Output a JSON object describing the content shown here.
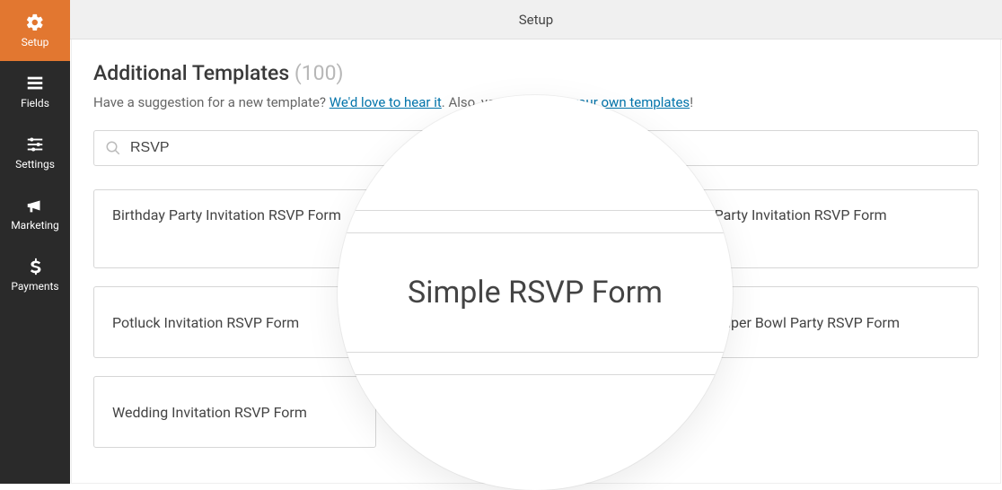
{
  "sidebar": {
    "items": [
      {
        "label": "Setup"
      },
      {
        "label": "Fields"
      },
      {
        "label": "Settings"
      },
      {
        "label": "Marketing"
      },
      {
        "label": "Payments"
      }
    ]
  },
  "topbar": {
    "title": "Setup"
  },
  "heading": {
    "title": "Additional Templates ",
    "count": "(100)"
  },
  "sub": {
    "text1": "Have a suggestion for a new template? ",
    "link1": "We'd love to hear it",
    "text2": ". Also, you can ",
    "link2": "create your own templates",
    "text3": "!"
  },
  "search": {
    "value": "RSVP"
  },
  "templates": [
    {
      "name": "Birthday Party Invitation RSVP Form"
    },
    {
      "name": ""
    },
    {
      "name": "Party Invitation RSVP Form"
    },
    {
      "name": "Potluck Invitation RSVP Form"
    },
    {
      "name": "Simple RSVP Form"
    },
    {
      "name": "Super Bowl Party RSVP Form"
    },
    {
      "name": "Wedding Invitation RSVP Form"
    }
  ],
  "magnifier": {
    "featured": "Simple RSVP Form"
  }
}
